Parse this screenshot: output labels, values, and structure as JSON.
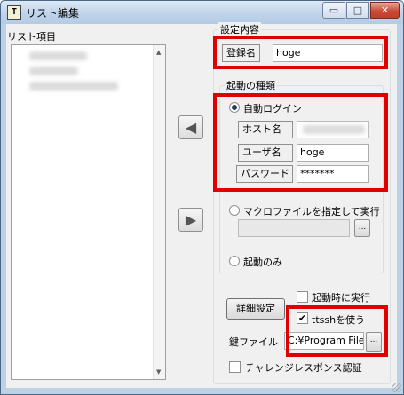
{
  "window": {
    "title": "リスト編集",
    "icon_label": "T",
    "controls": {
      "minimize": "▭",
      "maximize": "□",
      "close": "✕"
    }
  },
  "list": {
    "label": "リスト項目",
    "items_redacted": true
  },
  "arrows": {
    "left": "◀",
    "right": "▶"
  },
  "settings": {
    "legend": "設定内容",
    "register_name_label": "登録名",
    "register_name_value": "hoge"
  },
  "startup": {
    "legend": "起動の種類",
    "auto_login": {
      "label": "自動ログイン",
      "selected": true,
      "host_label": "ホスト名",
      "host_value": "",
      "user_label": "ユーザ名",
      "user_value": "hoge",
      "password_label": "パスワード",
      "password_value": "*******"
    },
    "macro": {
      "label": "マクロファイルを指定して実行",
      "selected": false,
      "browse_label": "..."
    },
    "launch_only": {
      "label": "起動のみ",
      "selected": false
    }
  },
  "bottom": {
    "detail_button": "詳細設定",
    "run_on_start": {
      "label": "起動時に実行",
      "checked": false
    },
    "use_ttssh": {
      "label": "ttsshを使う",
      "checked": true,
      "mark": "✔"
    },
    "key_file_label": "鍵ファイル",
    "key_file_value": "C:¥Program File",
    "key_browse": "...",
    "challenge_response": {
      "label": "チャレンジレスポンス認証",
      "checked": false
    }
  },
  "colors": {
    "highlight": "#e00000",
    "window_frame": "#bcd0e6",
    "client_bg": "#f0f0f0"
  }
}
